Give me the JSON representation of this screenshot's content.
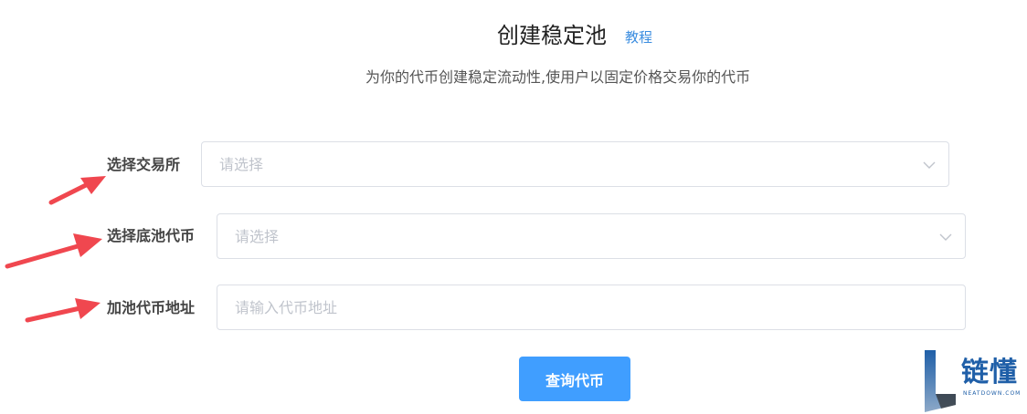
{
  "header": {
    "title": "创建稳定池",
    "tutorial_link": "教程",
    "subtitle": "为你的代币创建稳定流动性,使用户以固定价格交易你的代币"
  },
  "form": {
    "exchange": {
      "label": "选择交易所",
      "placeholder": "请选择"
    },
    "base_token": {
      "label": "选择底池代币",
      "placeholder": "请选择"
    },
    "pool_token_address": {
      "label": "加池代币地址",
      "placeholder": "请输入代币地址"
    },
    "submit_label": "查询代币"
  },
  "watermark": {
    "brand": "链懂",
    "domain": "NEATDOWN.COM"
  },
  "colors": {
    "primary": "#409eff",
    "link": "#3b8de0",
    "arrow": "#f0474f",
    "border": "#dcdfe6",
    "placeholder": "#c0c4cc",
    "watermark": "#1f5fa8"
  },
  "icons": {
    "dropdown": "chevron-down-icon",
    "annotation": "red-arrow-icon"
  }
}
